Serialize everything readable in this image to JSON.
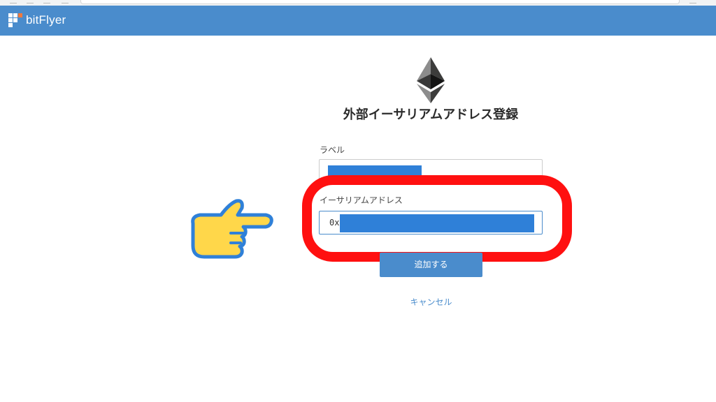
{
  "header": {
    "logo_text": "bitFlyer",
    "bar_color": "#4a8ccc"
  },
  "form": {
    "icon": "ethereum-icon",
    "title": "外部イーサリアムアドレス登録",
    "label_field": {
      "label": "ラベル",
      "value": ""
    },
    "address_field": {
      "label": "イーサリアムアドレス",
      "value": "0x"
    },
    "submit_label": "追加する",
    "cancel_label": "キャンセル"
  },
  "annotations": {
    "pointer": "pointing-hand-icon",
    "highlight_color": "#ff1010"
  }
}
